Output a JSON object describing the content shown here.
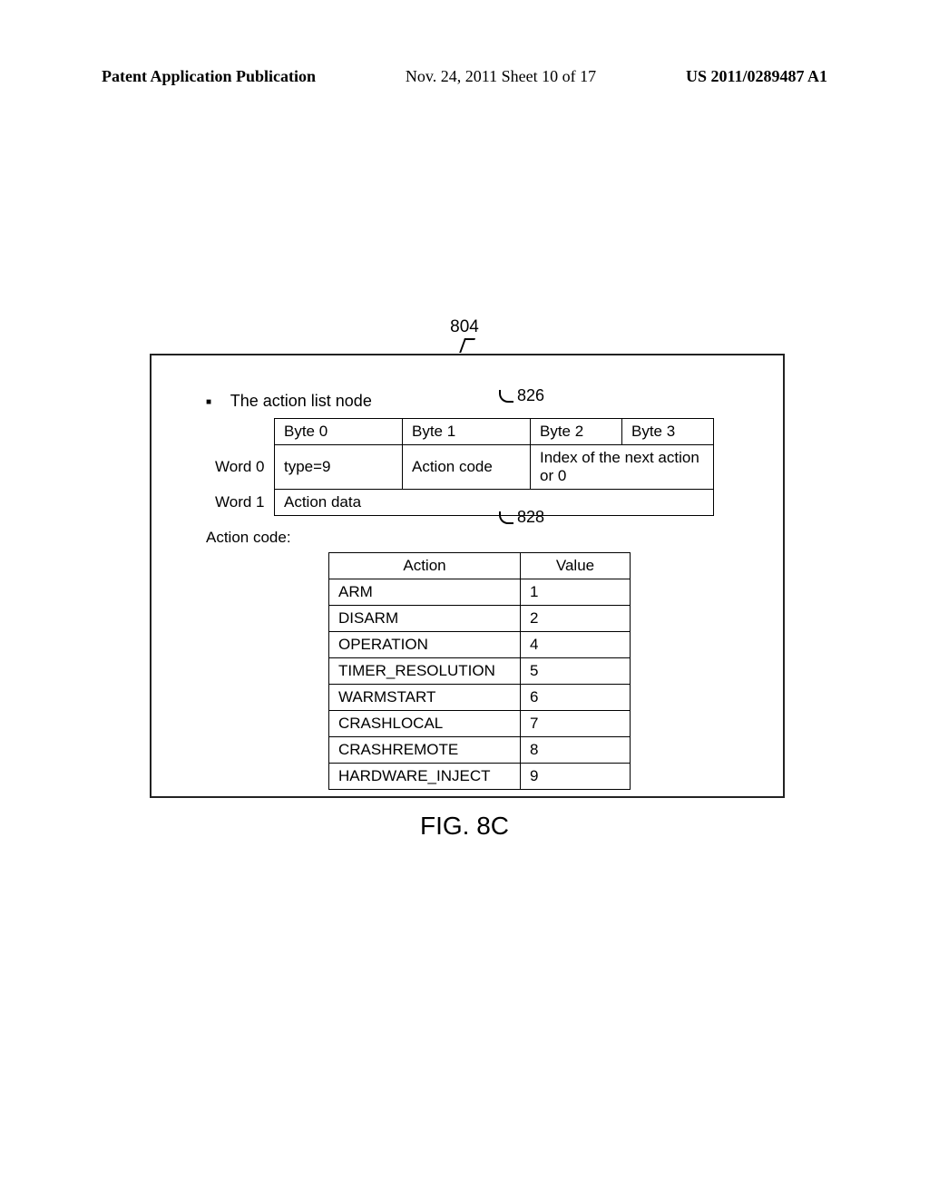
{
  "header": {
    "left": "Patent Application Publication",
    "mid": "Nov. 24, 2011  Sheet 10 of 17",
    "right": "US 2011/0289487 A1"
  },
  "refs": {
    "top": "804",
    "callout_826": "826",
    "callout_828": "828"
  },
  "bullet_title": "The action list node",
  "byte_table": {
    "headers": [
      "",
      "Byte 0",
      "Byte 1",
      "Byte 2",
      "Byte 3"
    ],
    "rows": [
      {
        "label": "Word 0",
        "cells": [
          "type=9",
          "Action code",
          "Index of the next action or 0"
        ]
      },
      {
        "label": "Word 1",
        "cells": [
          "Action data"
        ]
      }
    ]
  },
  "action_code_label": "Action code:",
  "action_table": {
    "headers": [
      "Action",
      "Value"
    ],
    "rows": [
      {
        "action": "ARM",
        "value": "1"
      },
      {
        "action": "DISARM",
        "value": "2"
      },
      {
        "action": "OPERATION",
        "value": "4"
      },
      {
        "action": "TIMER_RESOLUTION",
        "value": "5"
      },
      {
        "action": "WARMSTART",
        "value": "6"
      },
      {
        "action": "CRASHLOCAL",
        "value": "7"
      },
      {
        "action": "CRASHREMOTE",
        "value": "8"
      },
      {
        "action": "HARDWARE_INJECT",
        "value": "9"
      }
    ]
  },
  "figure_caption": "FIG. 8C"
}
